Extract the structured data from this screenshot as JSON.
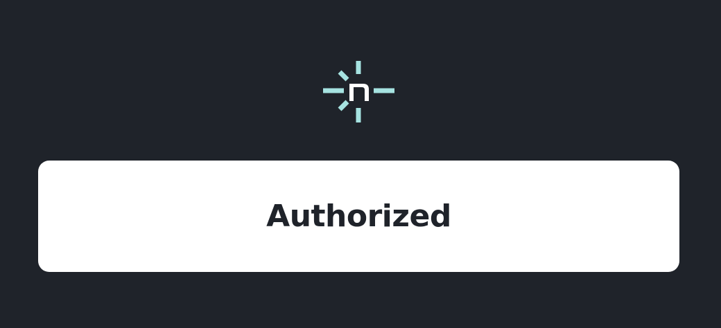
{
  "logo": {
    "icon": "netlify-logo-icon",
    "mark_color": "#a6e3e1",
    "letter_color": "#ffffff"
  },
  "status_card": {
    "title": "Authorized",
    "background": "#ffffff",
    "text_color": "#1f232a"
  },
  "page": {
    "background": "#1f232a"
  }
}
